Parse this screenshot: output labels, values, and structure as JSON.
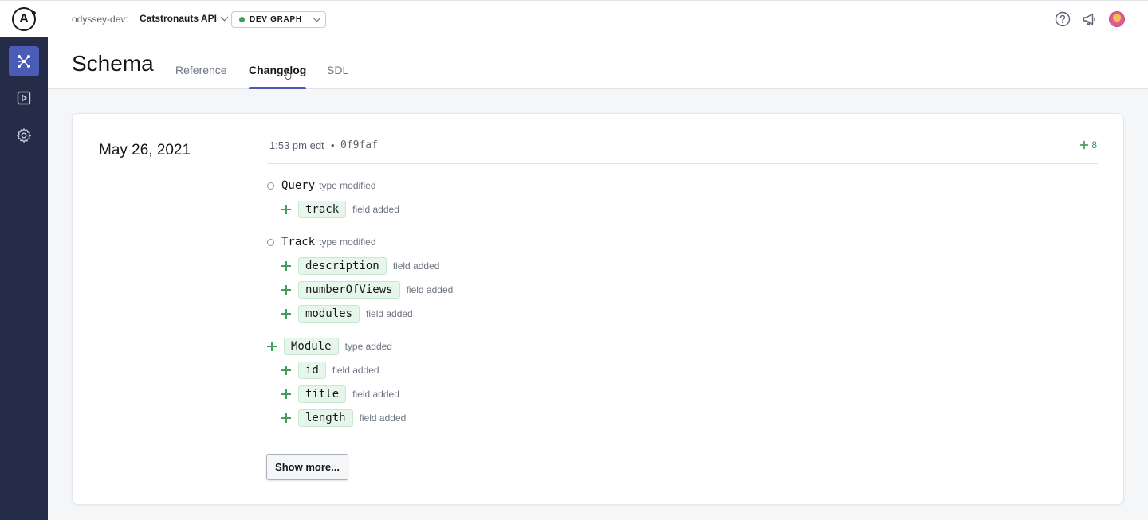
{
  "topbar": {
    "org_label": "odyssey-dev:",
    "graph_name": "Catstronauts API",
    "variant_label": "DEV GRAPH",
    "variant_status_color": "#3fa05b",
    "icons": [
      "help-icon",
      "announcements-icon",
      "user-avatar"
    ]
  },
  "sidebar": {
    "items": [
      {
        "name": "schema",
        "icon": "graph-icon",
        "active": true
      },
      {
        "name": "explorer",
        "icon": "play-icon",
        "active": false
      },
      {
        "name": "settings",
        "icon": "gear-icon",
        "active": false
      }
    ]
  },
  "page": {
    "title": "Schema",
    "tabs": [
      {
        "label": "Reference",
        "active": false
      },
      {
        "label": "Changelog",
        "active": true
      },
      {
        "label": "SDL",
        "active": false
      }
    ]
  },
  "changelog": {
    "date": "May 26, 2021",
    "time": "1:53 pm edt",
    "separator": "•",
    "hash": "0f9faf",
    "change_count": "8",
    "changes": [
      {
        "kind": "modified",
        "name": "Query",
        "desc": "type modified",
        "fields": [
          {
            "name": "track",
            "desc": "field added"
          }
        ]
      },
      {
        "kind": "modified",
        "name": "Track",
        "desc": "type modified",
        "fields": [
          {
            "name": "description",
            "desc": "field added"
          },
          {
            "name": "numberOfViews",
            "desc": "field added"
          },
          {
            "name": "modules",
            "desc": "field added"
          }
        ]
      },
      {
        "kind": "added",
        "name": "Module",
        "desc": "type added",
        "fields": [
          {
            "name": "id",
            "desc": "field added"
          },
          {
            "name": "title",
            "desc": "field added"
          },
          {
            "name": "length",
            "desc": "field added"
          }
        ]
      }
    ],
    "show_more_label": "Show more..."
  },
  "colors": {
    "accent": "#4b5cb6",
    "sidebar_bg": "#252c47",
    "added_green": "#3fa05b",
    "pill_bg": "#e6f6ea"
  }
}
